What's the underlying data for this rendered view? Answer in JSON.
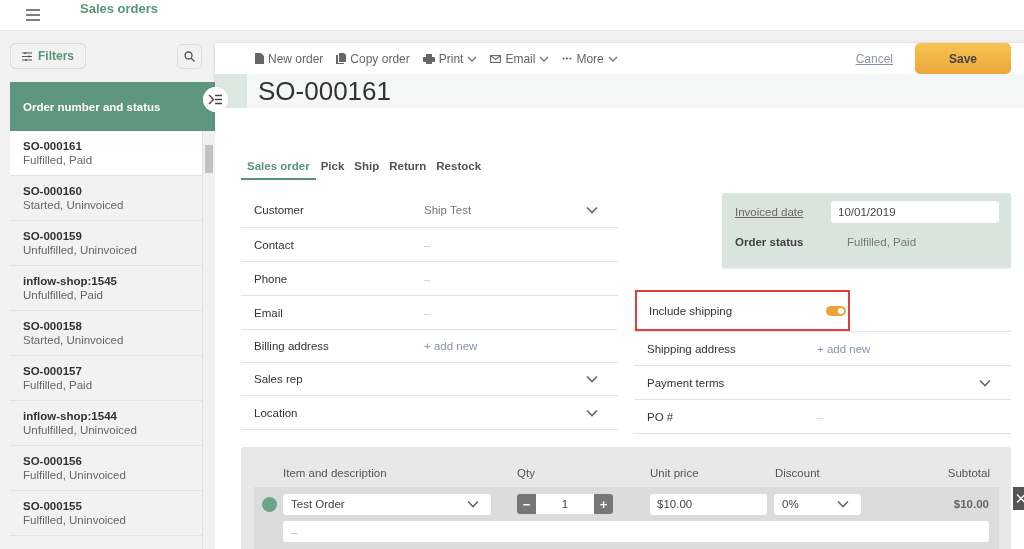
{
  "header": {
    "title": "Sales orders"
  },
  "sidebar": {
    "filters_label": "Filters",
    "list_title": "Order number and status",
    "orders": [
      {
        "number": "SO-000161",
        "status": "Fulfilled, Paid",
        "selected": true
      },
      {
        "number": "SO-000160",
        "status": "Started, Uninvoiced",
        "selected": false
      },
      {
        "number": "SO-000159",
        "status": "Unfulfilled, Uninvoiced",
        "selected": false
      },
      {
        "number": "inflow-shop:1545",
        "status": "Unfulfilled, Paid",
        "selected": false
      },
      {
        "number": "SO-000158",
        "status": "Started, Uninvoiced",
        "selected": false
      },
      {
        "number": "SO-000157",
        "status": "Fulfilled, Paid",
        "selected": false
      },
      {
        "number": "inflow-shop:1544",
        "status": "Unfulfilled, Uninvoiced",
        "selected": false
      },
      {
        "number": "SO-000156",
        "status": "Fulfilled, Uninvoiced",
        "selected": false
      },
      {
        "number": "SO-000155",
        "status": "Fulfilled, Uninvoiced",
        "selected": false
      }
    ]
  },
  "toolbar": {
    "actions": [
      {
        "label": "New order",
        "kind": "new",
        "dropdown": false
      },
      {
        "label": "Copy order",
        "kind": "copy",
        "dropdown": false
      },
      {
        "label": "Print",
        "kind": "print",
        "dropdown": true
      },
      {
        "label": "Email",
        "kind": "email",
        "dropdown": true
      },
      {
        "label": "More",
        "kind": "more",
        "dropdown": true
      }
    ],
    "cancel": "Cancel",
    "save": "Save"
  },
  "order_number": "SO-000161",
  "tabs": [
    {
      "label": "Sales order",
      "selected": true
    },
    {
      "label": "Pick",
      "selected": false
    },
    {
      "label": "Ship",
      "selected": false
    },
    {
      "label": "Return",
      "selected": false
    },
    {
      "label": "Restock",
      "selected": false
    }
  ],
  "left_fields": [
    {
      "label": "Customer",
      "value": "Ship Test",
      "kind": "dropdown"
    },
    {
      "label": "Contact",
      "placeholder": "–",
      "kind": "text"
    },
    {
      "label": "Phone",
      "placeholder": "–",
      "kind": "text"
    },
    {
      "label": "Email",
      "placeholder": "–",
      "kind": "text"
    },
    {
      "label": "Billing address",
      "value": "+ add new",
      "kind": "link"
    },
    {
      "label": "Sales rep",
      "kind": "dropdown"
    },
    {
      "label": "Location",
      "kind": "dropdown"
    }
  ],
  "status_card": {
    "invoiced_date_label": "Invoiced date",
    "invoiced_date": "10/01/2019",
    "order_status_label": "Order status",
    "order_status": "Fulfilled, Paid"
  },
  "include_shipping": {
    "label": "Include shipping",
    "on": true,
    "highlighted": true
  },
  "right_fields": [
    {
      "label": "Shipping address",
      "value": "+ add new",
      "kind": "link"
    },
    {
      "label": "Payment terms",
      "kind": "dropdown"
    },
    {
      "label": "PO #",
      "placeholder": "–",
      "kind": "text"
    }
  ],
  "line_items": {
    "columns": [
      "Item and description",
      "Qty",
      "Unit price",
      "Discount",
      "Subtotal"
    ],
    "rows": [
      {
        "color": "#6aa58a",
        "item": "Test Order",
        "decrement": "−",
        "qty": "1",
        "increment": "+",
        "unit_price": "$10.00",
        "discount": "0%",
        "subtotal": "$10.00",
        "description_placeholder": "–"
      }
    ]
  }
}
